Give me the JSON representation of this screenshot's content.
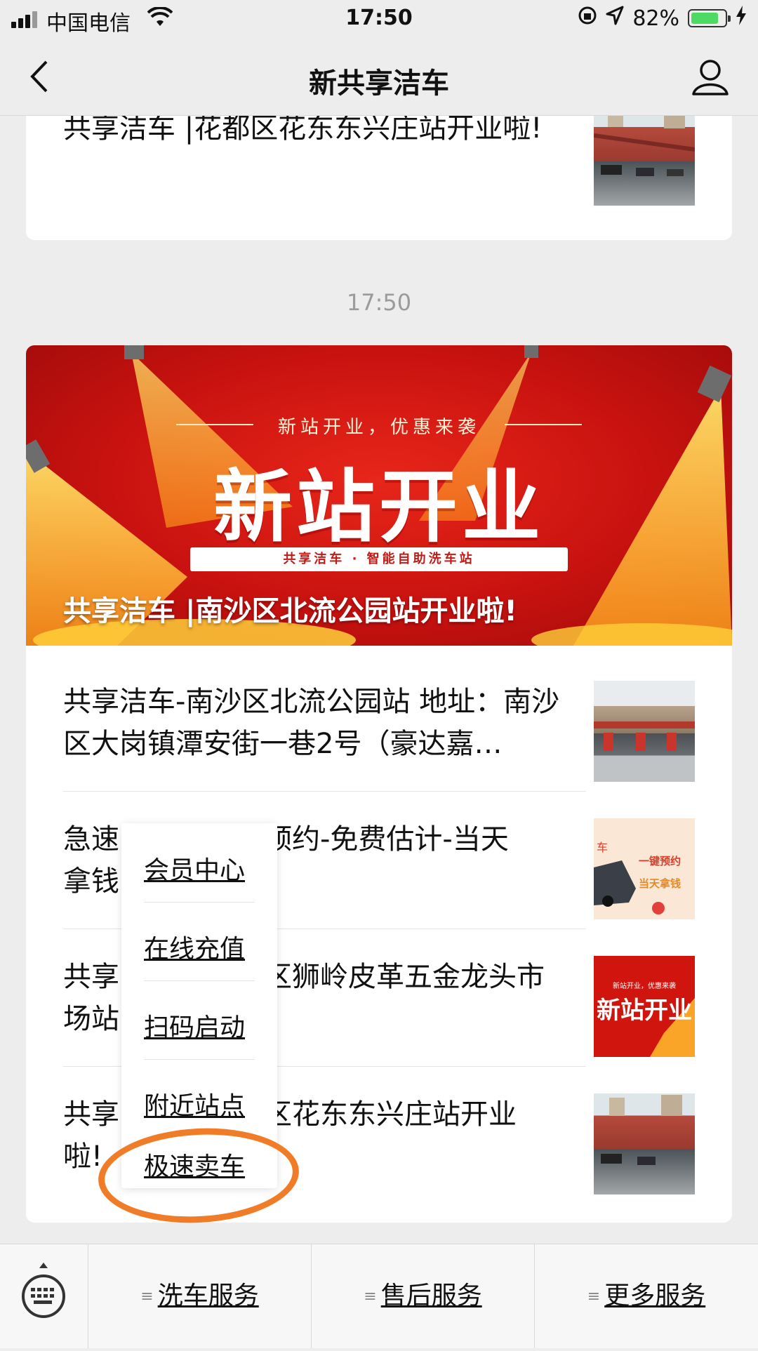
{
  "status_bar": {
    "carrier": "中国电信",
    "time": "17:50",
    "battery": "82%",
    "battery_level": 0.82,
    "colors": {
      "battery_fill": "#4cd964"
    }
  },
  "nav": {
    "title": "新共享洁车",
    "back_icon": "chevron-left-icon",
    "profile_icon": "user-icon"
  },
  "top_card": {
    "text": "共享洁车 |花都区花东东兴庄站开业啦!"
  },
  "timestamp": "17:50",
  "article_card": {
    "banner": {
      "subtitle": "新站开业，优惠来袭",
      "headline": "新站开业",
      "strip": "共享洁车 · 智能自助洗车站",
      "caption": "共享洁车 |南沙区北流公园站开业啦!"
    },
    "items": [
      {
        "text": "共享洁车-南沙区北流公园站 地址：南沙区大岗镇潭安街一巷2号（豪达嘉…"
      },
      {
        "text_head": "急速",
        "text_tail": "预约-免费估计-当天",
        "text_line2": "拿钱",
        "thumb_text_1": "车",
        "thumb_text_2": "一键预约",
        "thumb_text_3": "当天拿钱"
      },
      {
        "text_head": "共享",
        "text_tail": "区狮岭皮革五金龙头市",
        "text_line2": "场站",
        "thumb_text_1": "新站开业，优惠来袭",
        "thumb_text_2": "新站开业"
      },
      {
        "text_head": "共享",
        "text_tail": "区花东东兴庄站开业",
        "text_line2": "啦!"
      }
    ]
  },
  "popup_menu": {
    "items": [
      "会员中心",
      "在线充值",
      "扫码启动",
      "附近站点",
      "极速卖车"
    ],
    "highlight_color": "#f07c28"
  },
  "bottom_menu": {
    "keyboard_icon": "keyboard-icon",
    "tabs": [
      "洗车服务",
      "售后服务",
      "更多服务"
    ]
  }
}
